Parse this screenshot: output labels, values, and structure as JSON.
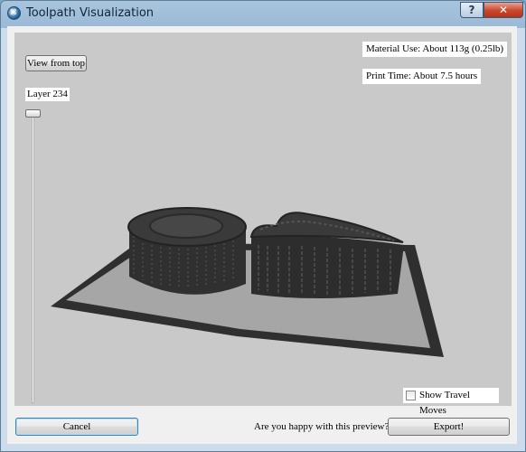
{
  "window": {
    "title": "Toolpath Visualization",
    "help_label": "?",
    "close_label": "✕"
  },
  "viewport": {
    "view_from_top_label": "View from top",
    "material_use": "Material Use: About 113g (0.25lb)",
    "print_time": "Print Time: About 7.5 hours",
    "layer_label": "Layer 234",
    "layer_slider_level": 1.0,
    "show_travel_moves_label": "Show Travel Moves",
    "show_travel_moves_checked": false
  },
  "footer": {
    "cancel_label": "Cancel",
    "question": "Are you happy with this preview?",
    "export_label": "Export!"
  },
  "icons": {
    "app": "app-icon",
    "help": "help-icon",
    "close": "close-icon"
  }
}
